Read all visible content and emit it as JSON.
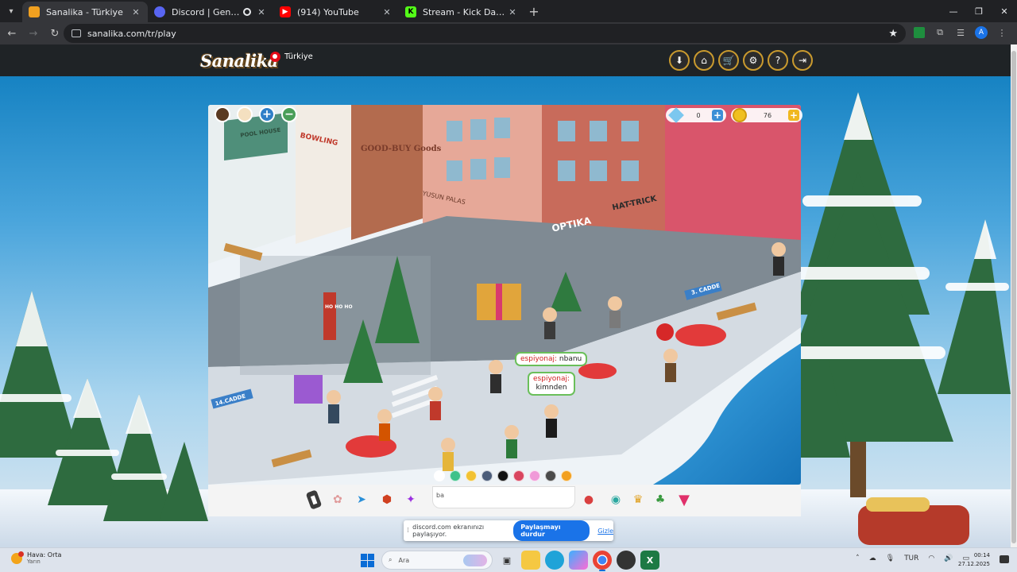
{
  "browser": {
    "tabs": [
      {
        "title": "Sanalika - Türkiye",
        "active": true,
        "favicon_color": "#f0a020"
      },
      {
        "title": "Discord | Genel | TAŞACAK",
        "active": false,
        "favicon_color": "#5865f2"
      },
      {
        "title": "(914) YouTube",
        "active": false,
        "favicon_color": "#ff0000"
      },
      {
        "title": "Stream - Kick Dashboard",
        "active": false,
        "favicon_color": "#53fc18"
      }
    ],
    "url": "sanalika.com/tr/play",
    "profile_initial": "A"
  },
  "site": {
    "logo_text": "Sanalika",
    "country": "Türkiye",
    "header_buttons": [
      "download-icon",
      "home-icon",
      "cart-icon",
      "gear-icon",
      "help-icon",
      "logout-icon"
    ]
  },
  "game": {
    "diamonds": "0",
    "coins": "76",
    "signs": {
      "bowling": "BOWLING",
      "goodbuy": "GOOD-BUY Goods",
      "optika": "OPTIKA",
      "hattrick": "HAT-TRICK",
      "yusun": "YUSUN PALAS",
      "street3": "3. CADDE",
      "street14": "14.CADDE",
      "pool": "POOL HOUSE",
      "hohoho": "HO HO HO"
    },
    "bubbles": [
      {
        "name": "espiyonaj:",
        "text": "nbanu"
      },
      {
        "name": "espiyonaj:",
        "text": "kimnden"
      }
    ],
    "chat_colors": [
      "#ffffff",
      "#3fc28a",
      "#f2c232",
      "#4b5d7a",
      "#111111",
      "#d9455f",
      "#f09ad8",
      "#4a4a4a",
      "#f2a020"
    ],
    "chat_input_text": "ba"
  },
  "share_bar": {
    "message": "discord.com ekranınızı paylaşıyor.",
    "stop_label": "Paylaşmayı durdur",
    "hide_label": "Gizle"
  },
  "taskbar": {
    "weather_title": "Hava: Orta",
    "weather_sub": "Yarın",
    "search_placeholder": "Ara",
    "lang": "TUR",
    "time": "00:14",
    "date": "27.12.2025"
  }
}
